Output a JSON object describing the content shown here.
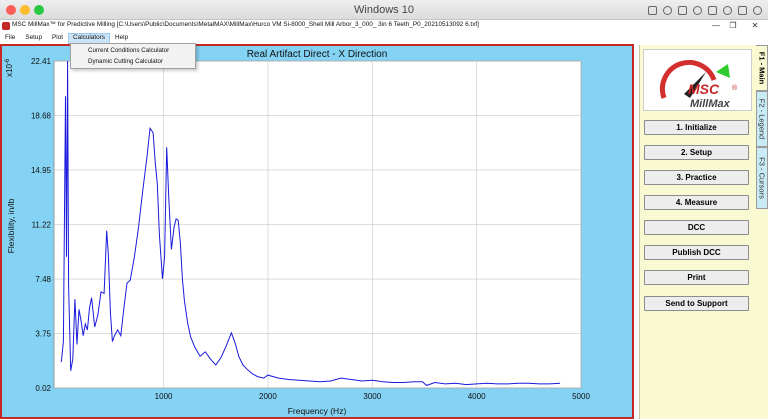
{
  "host": {
    "title": "Windows 10",
    "traffic_colors": [
      "#fc5f57",
      "#fdbc2e",
      "#28c840"
    ]
  },
  "window": {
    "title": "MSC MillMax™ for Predictive Milling [C:\\Users\\Public\\Documents\\MetalMAX\\MillMax\\Hurco  VM Si-8000_Shell Mill Arbor_3_000_ 3in 6 Teeth_P0_20210513092 6.txf]",
    "minimize": "—",
    "restore": "❐",
    "close": "✕"
  },
  "menu": {
    "items": [
      "File",
      "Setup",
      "Plot",
      "Calculators",
      "Help"
    ],
    "open_index": 3,
    "dropdown": [
      "Current Conditions Calculator",
      "Dynamic Cutting Calculator"
    ]
  },
  "plot": {
    "title": "Real Artifact Direct - X Direction",
    "xlabel": "Frequency (Hz)",
    "ylabel": "Flexibility, in/lb",
    "yexponent": "x10",
    "yexponent_sup": "-6",
    "colors": {
      "background": "#84d2f4",
      "plot_area": "#ffffff",
      "line": "#1a1adc",
      "grid": "#c8c8c8",
      "border": "#c62828"
    }
  },
  "chart_data": {
    "type": "line",
    "title": "Real Artifact Direct - X Direction",
    "xlabel": "Frequency (Hz)",
    "ylabel": "Flexibility, in/lb",
    "xlim": [
      -50,
      5000
    ],
    "ylim": [
      0.02,
      22.41
    ],
    "xticks": [
      "1000",
      "2000",
      "3000",
      "4000",
      "5000"
    ],
    "yticks": [
      "0.02",
      "3.75",
      "7.48",
      "11.22",
      "14.95",
      "18.68",
      "22.41"
    ],
    "grid": true,
    "series": [
      {
        "x": [
          20,
          40,
          60,
          70,
          80,
          90,
          110,
          130,
          150,
          170,
          190,
          210,
          230,
          250,
          270,
          290,
          310,
          340,
          370,
          400,
          430,
          455,
          470,
          490,
          510,
          530,
          560,
          590,
          620,
          650,
          680,
          720,
          760,
          800,
          840,
          870,
          900,
          920,
          940,
          960,
          990,
          1010,
          1030,
          1050,
          1075,
          1100,
          1120,
          1140,
          1160,
          1180,
          1200,
          1230,
          1260,
          1300,
          1350,
          1400,
          1450,
          1500,
          1550,
          1600,
          1650,
          1690,
          1720,
          1760,
          1800,
          1850,
          1900,
          1960,
          2000,
          2100,
          2200,
          2300,
          2400,
          2500,
          2600,
          2700,
          2800,
          2900,
          3000,
          3100,
          3200,
          3300,
          3400,
          3480,
          3520,
          3600,
          3700,
          3800,
          3900,
          4000,
          4100,
          4200,
          4300,
          4400,
          4500,
          4600,
          4700,
          4800
        ],
        "y": [
          1.8,
          3.2,
          20.0,
          9.0,
          22.41,
          7.0,
          1.2,
          2.0,
          6.1,
          3.0,
          5.4,
          4.6,
          3.6,
          4.4,
          4.0,
          5.5,
          6.2,
          4.2,
          5.0,
          6.6,
          6.5,
          10.8,
          9.2,
          5.2,
          3.2,
          3.6,
          4.0,
          3.6,
          5.5,
          7.2,
          7.4,
          9.0,
          11.0,
          13.5,
          15.8,
          17.8,
          17.5,
          15.5,
          14.0,
          10.5,
          7.5,
          9.0,
          16.5,
          13.0,
          9.5,
          11.0,
          11.6,
          11.5,
          10.0,
          7.5,
          6.0,
          4.5,
          3.5,
          2.8,
          2.2,
          2.5,
          2.0,
          1.6,
          2.1,
          2.9,
          3.8,
          3.0,
          2.2,
          1.6,
          1.3,
          1.0,
          0.8,
          0.7,
          0.9,
          0.7,
          0.6,
          0.55,
          0.5,
          0.45,
          0.5,
          0.7,
          0.6,
          0.5,
          0.55,
          0.45,
          0.4,
          0.4,
          0.45,
          0.45,
          0.2,
          0.4,
          0.3,
          0.35,
          0.25,
          0.3,
          0.35,
          0.3,
          0.3,
          0.35,
          0.35,
          0.3,
          0.3,
          0.35
        ]
      }
    ]
  },
  "side": {
    "logo_text": "MSC",
    "logo_sub": "MillMax",
    "logo_mark": "®",
    "buttons": [
      "1. Initialize",
      "2. Setup",
      "3. Practice",
      "4. Measure",
      "DCC",
      "Publish DCC",
      "Print",
      "Send to Support"
    ]
  },
  "tabs": [
    "F1 - Main",
    "F2 - Legend",
    "F3 - Cursors"
  ]
}
